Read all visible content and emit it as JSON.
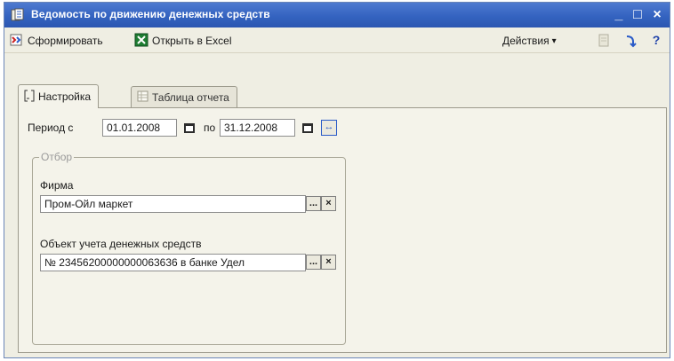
{
  "window": {
    "title": "Ведомость по движению денежных средств",
    "minimize_glyph": "_",
    "maximize_glyph": "□",
    "close_glyph": "×",
    "title_color": "#3463c0"
  },
  "toolbar": {
    "generate_label": "Сформировать",
    "open_excel_label": "Открыть в Excel",
    "actions_label": "Действия",
    "actions_arrow": "▾",
    "help_glyph": "?",
    "icons": [
      "generate-icon",
      "excel-icon",
      "bookmark-icon",
      "arrow-icon",
      "help-icon"
    ]
  },
  "tabs": [
    {
      "label": "Настройка",
      "active": true,
      "icon": "settings-tab-icon"
    },
    {
      "label": "Таблица отчета",
      "active": false,
      "icon": "table-tab-icon"
    }
  ],
  "settings": {
    "period_from_label": "Период с",
    "period_from_value": "01.01.2008",
    "period_to_label": "по",
    "period_to_value": "31.12.2008",
    "period_picker_glyph": "↔"
  },
  "filter": {
    "group_title": "Отбор",
    "firm_label": "Фирма",
    "firm_value": "Пром-Ойл маркет",
    "account_label": "Объект учета денежных средств",
    "account_value": "№ 23456200000000063636 в банке Удел",
    "select_glyph": "...",
    "clear_glyph": "×"
  }
}
